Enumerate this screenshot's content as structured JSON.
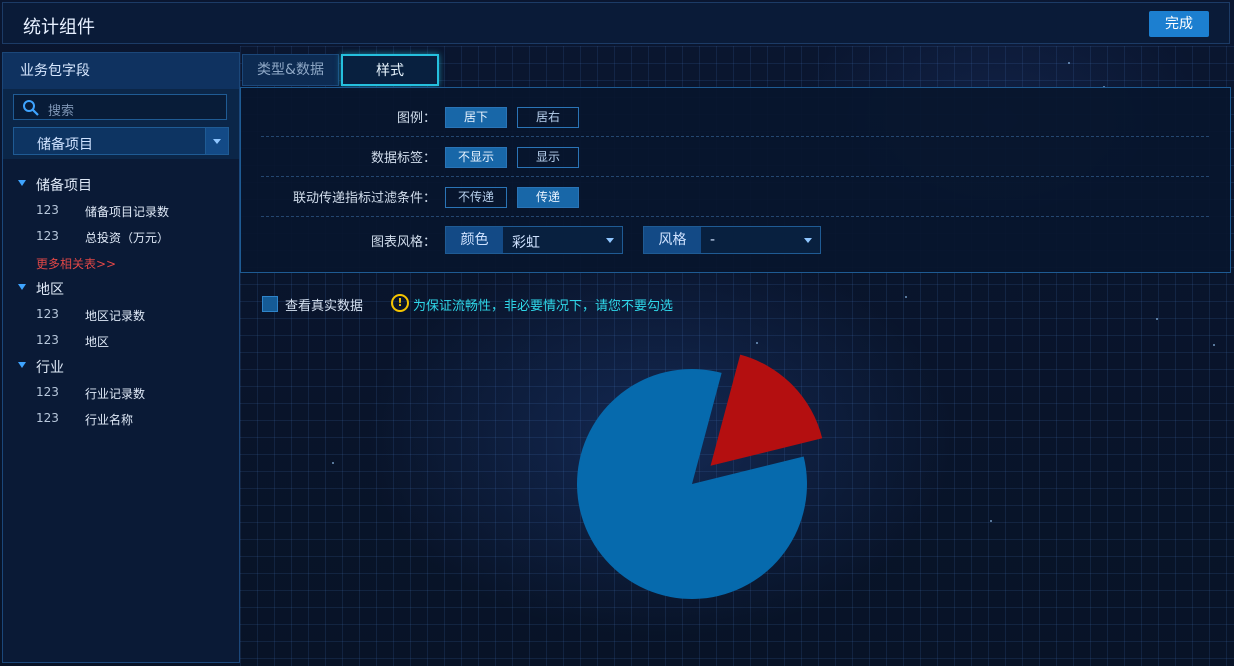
{
  "header": {
    "title": "统计组件",
    "done_label": "完成"
  },
  "sidebar": {
    "title": "业务包字段",
    "search_placeholder": "搜索",
    "selected_package": "储备项目",
    "groups": [
      {
        "label": "储备项目",
        "fields": [
          {
            "type": "123",
            "name": "储备项目记录数"
          },
          {
            "type": "123",
            "name": "总投资（万元）"
          }
        ],
        "more": "更多相关表>>"
      },
      {
        "label": "地区",
        "fields": [
          {
            "type": "123",
            "name": "地区记录数"
          },
          {
            "type": "123",
            "name": "地区"
          }
        ]
      },
      {
        "label": "行业",
        "fields": [
          {
            "type": "123",
            "name": "行业记录数"
          },
          {
            "type": "123",
            "name": "行业名称"
          }
        ]
      }
    ]
  },
  "tabs": [
    {
      "label": "类型&数据",
      "active": false
    },
    {
      "label": "样式",
      "active": true
    }
  ],
  "style_settings": {
    "legend": {
      "label": "图例：",
      "options": [
        "居下",
        "居右"
      ],
      "selected": "居下"
    },
    "data_label": {
      "label": "数据标签：",
      "options": [
        "不显示",
        "显示"
      ],
      "selected": "不显示"
    },
    "linkage": {
      "label": "联动传递指标过滤条件：",
      "options": [
        "不传递",
        "传递"
      ],
      "selected": "传递"
    },
    "chart_style": {
      "label": "图表风格：",
      "color_key": "颜色",
      "color_value": "彩虹",
      "style_key": "风格",
      "style_value": "-"
    }
  },
  "real_data": {
    "label": "查看真实数据",
    "checked": false,
    "warning": "为保证流畅性，非必要情况下，请您不要勾选"
  },
  "chart_data": {
    "type": "pie",
    "title": "",
    "slices": [
      {
        "value": 0.83,
        "color": "#066aad"
      },
      {
        "value": 0.17,
        "color": "#b40f10",
        "exploded": true
      }
    ]
  },
  "colors": {
    "accent": "#1c7fd0",
    "pie_blue": "#066aad",
    "pie_red": "#b40f10",
    "warning": "#2fd6e8"
  }
}
